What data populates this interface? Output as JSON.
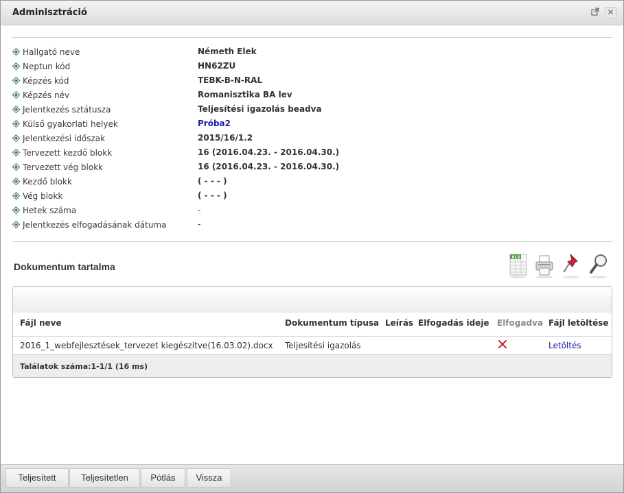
{
  "window": {
    "title": "Adminisztráció",
    "popout_icon": "popout-icon",
    "close_icon": "close-icon"
  },
  "details": [
    {
      "label": "Hallgató neve",
      "value": "Németh Elek"
    },
    {
      "label": "Neptun kód",
      "value": "HN62ZU"
    },
    {
      "label": "Képzés kód",
      "value": "TEBK-B-N-RAL"
    },
    {
      "label": "Képzés név",
      "value": "Romanisztika BA lev"
    },
    {
      "label": "Jelentkezés sztátusza",
      "value": "Teljesítési igazolás beadva"
    },
    {
      "label": "Külső gyakorlati helyek",
      "value": "Próba2"
    },
    {
      "label": "Jelentkezési időszak",
      "value": "2015/16/1.2"
    },
    {
      "label": "Tervezett kezdő blokk",
      "value": "16 (2016.04.23. - 2016.04.30.)"
    },
    {
      "label": "Tervezett vég blokk",
      "value": "16 (2016.04.23. - 2016.04.30.)"
    },
    {
      "label": "Kezdő blokk",
      "value": "( - - - )"
    },
    {
      "label": "Vég blokk",
      "value": "( - - - )"
    },
    {
      "label": "Hetek száma",
      "value": "-"
    },
    {
      "label": "Jelentkezés elfogadásának dátuma",
      "value": "-"
    }
  ],
  "document_section": {
    "title": "Dokumentum tartalma",
    "tools": [
      "xls-export-icon",
      "print-icon",
      "pin-icon",
      "search-icon"
    ]
  },
  "table": {
    "columns": [
      "Fájl neve",
      "Dokumentum típusa",
      "Leírás",
      "Elfogadás ideje",
      "Elfogadva",
      "Fájl letöltése"
    ],
    "rows": [
      {
        "file_name": "2016_1_webfejlesztések_tervezet kiegészítve(16.03.02).docx",
        "doc_type": "Teljesítési igazolás",
        "description": "",
        "accepted_at": "",
        "accepted_icon": "cross-icon",
        "download": "Letöltés"
      }
    ],
    "footer": "Találatok száma:1-1/1 (16 ms)"
  },
  "buttons": {
    "completed": "Teljesített",
    "not_completed": "Teljesítetlen",
    "supplement": "Pótlás",
    "back": "Vissza"
  },
  "colors": {
    "link": "#1a1aa6",
    "cross": "#c0283a",
    "bullet": "#3a6d7a"
  }
}
